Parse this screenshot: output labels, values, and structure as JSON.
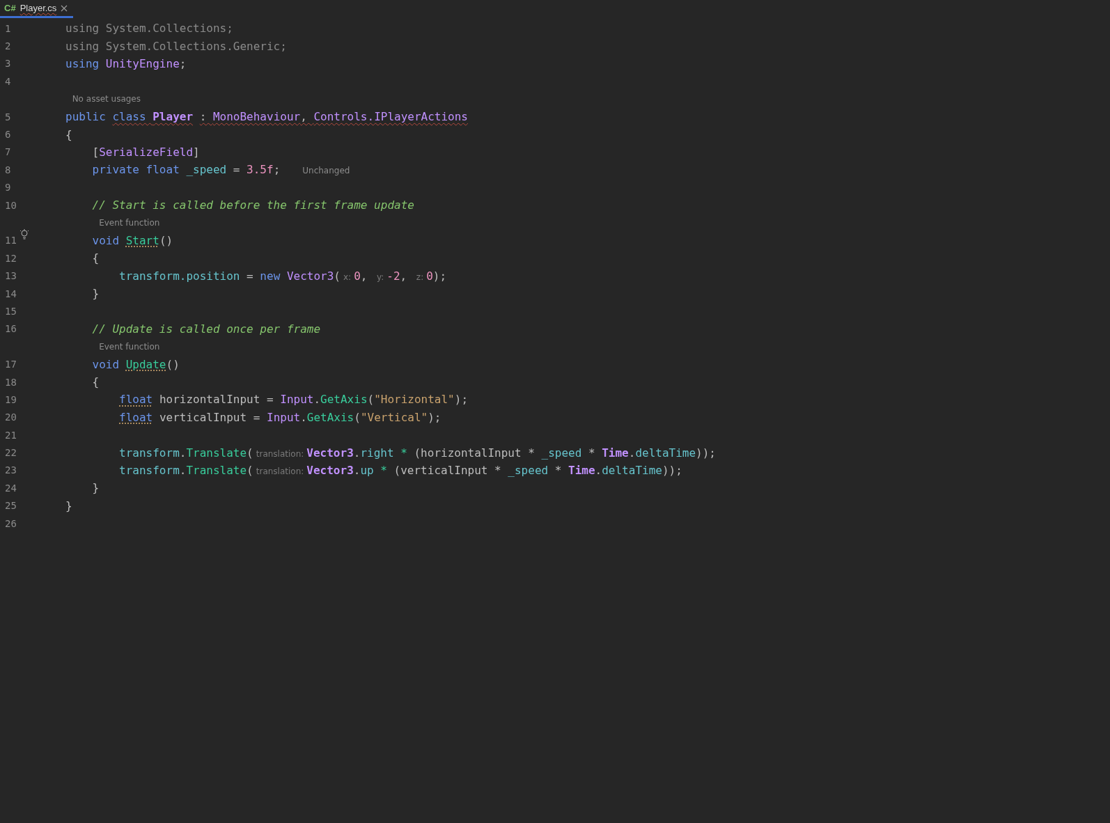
{
  "tab": {
    "badge": "C#",
    "title": "Player.cs",
    "selected": true
  },
  "lines": [
    {
      "kind": "code",
      "number": "1",
      "bulb": false,
      "tokens": [
        {
          "kind": "dim",
          "t": "using System.Collections;"
        }
      ]
    },
    {
      "kind": "code",
      "number": "2",
      "bulb": false,
      "tokens": [
        {
          "kind": "dim",
          "t": "using System.Collections.Generic;"
        }
      ]
    },
    {
      "kind": "code",
      "number": "3",
      "bulb": false,
      "tokens": [
        {
          "kind": "kw",
          "t": "using "
        },
        {
          "kind": "type",
          "t": "UnityEngine"
        },
        {
          "kind": "plain",
          "t": ";"
        }
      ]
    },
    {
      "kind": "code",
      "number": "4",
      "bulb": false
    },
    {
      "kind": "lens",
      "text": "No asset usages"
    },
    {
      "kind": "code",
      "number": "5",
      "bulb": false,
      "tokens": [
        {
          "kind": "kw",
          "t": "public "
        },
        {
          "kind": "kwerr",
          "t": "class "
        },
        {
          "kind": "typeberr",
          "t": "Player"
        },
        {
          "kind": "plainerr",
          "t": " : "
        },
        {
          "kind": "typeerr",
          "t": "MonoBehaviour"
        },
        {
          "kind": "plainerr",
          "t": ", "
        },
        {
          "kind": "typeerr",
          "t": "Controls.IPlayerActions"
        }
      ]
    },
    {
      "kind": "code",
      "number": "6",
      "bulb": false,
      "tokens": [
        {
          "kind": "plain",
          "t": "{"
        }
      ]
    },
    {
      "kind": "code",
      "number": "7",
      "bulb": false,
      "tokens": [
        {
          "kind": "plain",
          "t": "    ["
        },
        {
          "kind": "type",
          "t": "SerializeField"
        },
        {
          "kind": "plain",
          "t": "]"
        }
      ]
    },
    {
      "kind": "code",
      "number": "8",
      "bulb": false,
      "tokens": [
        {
          "kind": "kw",
          "t": "    private float "
        },
        {
          "kind": "field",
          "t": "_speed"
        },
        {
          "kind": "plain",
          "t": " = "
        },
        {
          "kind": "number",
          "t": "3.5f"
        },
        {
          "kind": "plain",
          "t": ";"
        },
        {
          "kind": "lensinline",
          "t": "Unchanged"
        }
      ]
    },
    {
      "kind": "code",
      "number": "9",
      "bulb": false
    },
    {
      "kind": "code",
      "number": "10",
      "bulb": false,
      "tokens": [
        {
          "kind": "comment",
          "t": "    // Start is called before the first frame update"
        }
      ]
    },
    {
      "kind": "lens",
      "text": "Event function"
    },
    {
      "kind": "code",
      "number": "11",
      "bulb": true,
      "tokens": [
        {
          "kind": "kw",
          "t": "    void "
        },
        {
          "kind": "methoddot",
          "t": "Start"
        },
        {
          "kind": "plain",
          "t": "()"
        }
      ]
    },
    {
      "kind": "code",
      "number": "12",
      "bulb": false,
      "tokens": [
        {
          "kind": "plain",
          "t": "    {"
        }
      ]
    },
    {
      "kind": "code",
      "number": "13",
      "bulb": false,
      "tokens": [
        {
          "kind": "field",
          "t": "        transform.position"
        },
        {
          "kind": "plain",
          "t": " = "
        },
        {
          "kind": "kw",
          "t": "new "
        },
        {
          "kind": "type",
          "t": "Vector3"
        },
        {
          "kind": "plain",
          "t": "("
        },
        {
          "kind": "hint",
          "t": "x:"
        },
        {
          "kind": "number",
          "t": "0"
        },
        {
          "kind": "plain",
          "t": ", "
        },
        {
          "kind": "hint",
          "t": "y:"
        },
        {
          "kind": "number",
          "t": "-2"
        },
        {
          "kind": "plain",
          "t": ", "
        },
        {
          "kind": "hint",
          "t": "z:"
        },
        {
          "kind": "number",
          "t": "0"
        },
        {
          "kind": "plain",
          "t": ");"
        }
      ]
    },
    {
      "kind": "code",
      "number": "14",
      "bulb": false,
      "tokens": [
        {
          "kind": "plain",
          "t": "    }"
        }
      ]
    },
    {
      "kind": "code",
      "number": "15",
      "bulb": false
    },
    {
      "kind": "code",
      "number": "16",
      "bulb": false,
      "tokens": [
        {
          "kind": "comment",
          "t": "    // Update is called once per frame"
        }
      ]
    },
    {
      "kind": "lens",
      "text": "Event function"
    },
    {
      "kind": "code",
      "number": "17",
      "bulb": false,
      "tokens": [
        {
          "kind": "kw",
          "t": "    void "
        },
        {
          "kind": "methoddot",
          "t": "Update"
        },
        {
          "kind": "plain",
          "t": "()"
        }
      ]
    },
    {
      "kind": "code",
      "number": "18",
      "bulb": false,
      "tokens": [
        {
          "kind": "plain",
          "t": "    {"
        }
      ]
    },
    {
      "kind": "code",
      "number": "19",
      "bulb": false,
      "tokens": [
        {
          "kind": "kwdot",
          "t": "        float"
        },
        {
          "kind": "plain",
          "t": " horizontalInput = "
        },
        {
          "kind": "type",
          "t": "Input"
        },
        {
          "kind": "plain",
          "t": "."
        },
        {
          "kind": "method",
          "t": "GetAxis"
        },
        {
          "kind": "plain",
          "t": "("
        },
        {
          "kind": "string",
          "t": "\"Horizontal\""
        },
        {
          "kind": "plain",
          "t": ");"
        }
      ]
    },
    {
      "kind": "code",
      "number": "20",
      "bulb": false,
      "tokens": [
        {
          "kind": "kwdot",
          "t": "        float"
        },
        {
          "kind": "plain",
          "t": " verticalInput = "
        },
        {
          "kind": "type",
          "t": "Input"
        },
        {
          "kind": "plain",
          "t": "."
        },
        {
          "kind": "method",
          "t": "GetAxis"
        },
        {
          "kind": "plain",
          "t": "("
        },
        {
          "kind": "string",
          "t": "\"Vertical\""
        },
        {
          "kind": "plain",
          "t": ");"
        }
      ]
    },
    {
      "kind": "code",
      "number": "21",
      "bulb": false
    },
    {
      "kind": "code",
      "number": "22",
      "bulb": false,
      "tokens": [
        {
          "kind": "field",
          "t": "        transform"
        },
        {
          "kind": "plain",
          "t": "."
        },
        {
          "kind": "method",
          "t": "Translate"
        },
        {
          "kind": "plain",
          "t": "("
        },
        {
          "kind": "hint",
          "t": "translation:"
        },
        {
          "kind": "typeb",
          "t": "Vector3"
        },
        {
          "kind": "plain",
          "t": "."
        },
        {
          "kind": "field",
          "t": "right"
        },
        {
          "kind": "op",
          "t": " * "
        },
        {
          "kind": "plain",
          "t": "(horizontalInput * "
        },
        {
          "kind": "field",
          "t": "_speed"
        },
        {
          "kind": "plain",
          "t": " * "
        },
        {
          "kind": "typeb",
          "t": "Time"
        },
        {
          "kind": "plain",
          "t": "."
        },
        {
          "kind": "field",
          "t": "deltaTime"
        },
        {
          "kind": "plain",
          "t": "));"
        }
      ]
    },
    {
      "kind": "code",
      "number": "23",
      "bulb": false,
      "tokens": [
        {
          "kind": "field",
          "t": "        transform"
        },
        {
          "kind": "plain",
          "t": "."
        },
        {
          "kind": "method",
          "t": "Translate"
        },
        {
          "kind": "plain",
          "t": "("
        },
        {
          "kind": "hint",
          "t": "translation:"
        },
        {
          "kind": "typeb",
          "t": "Vector3"
        },
        {
          "kind": "plain",
          "t": "."
        },
        {
          "kind": "field",
          "t": "up"
        },
        {
          "kind": "op",
          "t": " * "
        },
        {
          "kind": "plain",
          "t": "(verticalInput * "
        },
        {
          "kind": "field",
          "t": "_speed"
        },
        {
          "kind": "plain",
          "t": " * "
        },
        {
          "kind": "typeb",
          "t": "Time"
        },
        {
          "kind": "plain",
          "t": "."
        },
        {
          "kind": "field",
          "t": "deltaTime"
        },
        {
          "kind": "plain",
          "t": "));"
        }
      ]
    },
    {
      "kind": "code",
      "number": "24",
      "bulb": false,
      "tokens": [
        {
          "kind": "plain",
          "t": "    }"
        }
      ]
    },
    {
      "kind": "code",
      "number": "25",
      "bulb": false,
      "tokens": [
        {
          "kind": "plain",
          "t": "}"
        }
      ]
    },
    {
      "kind": "code",
      "number": "26",
      "bulb": false
    }
  ]
}
